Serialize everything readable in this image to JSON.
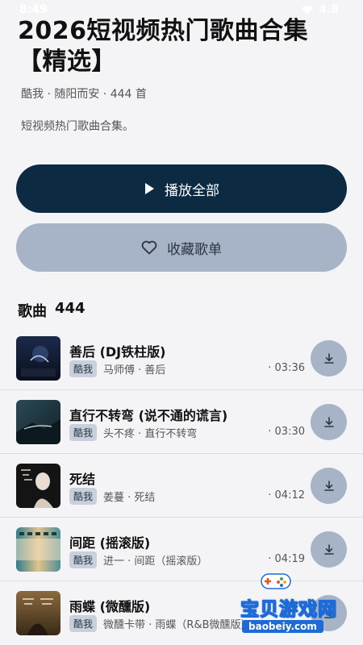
{
  "status_bar": {
    "time": "8:49",
    "battery": "4.8"
  },
  "playlist": {
    "title": "2026短视频热门歌曲合集【精选】",
    "meta": "酷我 · 随阳而安 · 444 首",
    "description": "短视频热门歌曲合集。"
  },
  "actions": {
    "play_all_label": "播放全部",
    "favorite_label": "收藏歌单",
    "play_icon": "play-icon",
    "heart_icon": "heart-outline-icon"
  },
  "songs_section": {
    "label": "歌曲",
    "count": "444"
  },
  "songs": [
    {
      "title": "善后 (DJ铁柱版)",
      "source": "酷我",
      "subtitle": "马师傅 · 善后",
      "duration": "· 03:36"
    },
    {
      "title": "直行不转弯 (说不通的谎言)",
      "source": "酷我",
      "subtitle": "头不疼 · 直行不转弯",
      "duration": "· 03:30"
    },
    {
      "title": "死结",
      "source": "酷我",
      "subtitle": "姜蔓 · 死结",
      "duration": "· 04:12"
    },
    {
      "title": "间距 (摇滚版)",
      "source": "酷我",
      "subtitle": "进一 · 间距（摇滚版）",
      "duration": "· 04:19"
    },
    {
      "title": "雨蝶 (微醺版)",
      "source": "酷我",
      "subtitle": "微醺卡带 · 雨蝶（R&B微醺版）",
      "duration": ""
    }
  ],
  "watermark": {
    "text": "宝贝游戏网",
    "url": "baobeiy.com"
  },
  "colors": {
    "background": "#f4f4f6",
    "play_button": "#0d2a43",
    "secondary_button": "#a7b4c7",
    "tag": "#c7d0dc",
    "watermark_blue": "#1e6bd6"
  }
}
